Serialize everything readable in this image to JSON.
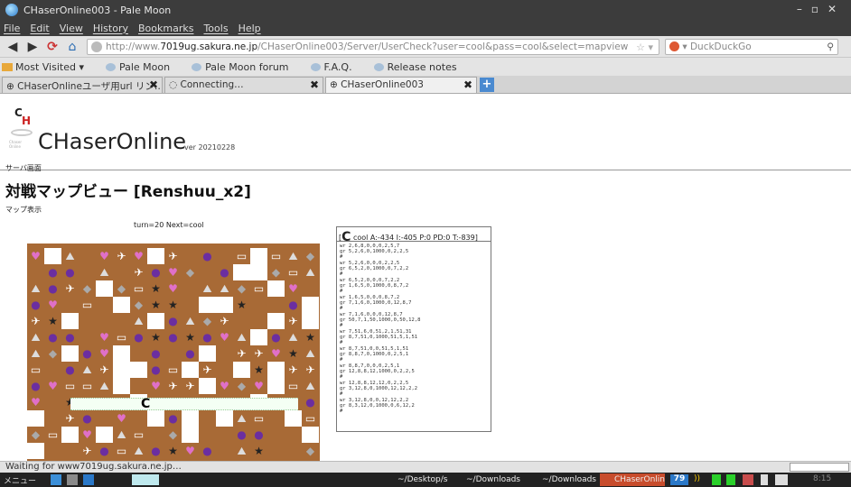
{
  "window": {
    "title": "CHaserOnline003 - Pale Moon"
  },
  "menu": [
    "File",
    "Edit",
    "View",
    "History",
    "Bookmarks",
    "Tools",
    "Help"
  ],
  "nav": {
    "url_prefix": "http://www.",
    "url_host": "7019ug.sakura.ne.jp",
    "url_path": "/CHaserOnline003/Server/UserCheck?user=cool&pass=cool&select=mapview",
    "search_engine": "DuckDuckGo"
  },
  "bookmarks": [
    "Most Visited ▾",
    "Pale Moon",
    "Pale Moon forum",
    "F.A.Q.",
    "Release notes"
  ],
  "tabs": [
    {
      "label": "CHaserOnlineユーザ用url リン…"
    },
    {
      "label": "Connecting…"
    },
    {
      "label": "CHaserOnline003"
    }
  ],
  "page": {
    "logo_caption": "Chaser Online",
    "app_title": "CHaserOnline",
    "app_version": "ver 20210228",
    "breadcrumb": "サーバ画面",
    "heading": "対戦マップビュー [Renshuu_x2]",
    "subheading": "マップ表示",
    "turn_info": "turn=20 Next=cool",
    "panel_header_letter": "C",
    "panel_header_text": "cool A:-434 I:-405 P:0 PD:0 T:-839]",
    "log": [
      [
        "wr 2,6,8,0,0,0,2,5,7",
        "gr 5,2,6,0,1000,0,2,2,5",
        "#"
      ],
      [
        "wr 5,2,6,0,0,0,2,2,5",
        "gr 6,5,2,0,1000,0,7,2,2",
        "#"
      ],
      [
        "wr 6,5,2,0,0,0,7,2,2",
        "gr 1,6,5,0,1000,0,8,7,2",
        "#"
      ],
      [
        "wr 1,6,5,0,0,0,8,7,2",
        "gr 7,1,6,0,1000,0,12,8,7",
        "#"
      ],
      [
        "wr 7,1,6,0,0,0,12,8,7",
        "gr 50,7,1,50,1000,0,50,12,8",
        "#"
      ],
      [
        "wr 7,51,6,0,51,2,1,51,31",
        "gr 8,7,51,0,1000,51,5,1,51",
        "#"
      ],
      [
        "wr 8,7,51,0,0,51,5,1,51",
        "gr 8,8,7,0,1000,0,2,5,1",
        "#"
      ],
      [
        "wr 8,8,7,0,0,0,2,5,1",
        "gr 12,8,8,12,1000,0,2,2,5",
        "#"
      ],
      [
        "wr 12,8,8,12,12,0,2,2,5",
        "gr 3,12,8,0,1000,12,12,2,2",
        "#"
      ],
      [
        "wr 3,12,8,0,0,12,12,2,2",
        "gr 8,3,12,0,1000,0,6,12,2",
        "#"
      ]
    ],
    "player_marker": "C"
  },
  "status_text": "Waiting for www7019ug.sakura.ne.jp…",
  "taskbar": {
    "start": "メニュー",
    "items": [
      "~/Desktop/sc",
      "~/Downloads",
      "~/Downloads",
      "CHaserOnlin"
    ],
    "badge": "79",
    "clock": "8:15"
  },
  "colors": {
    "board_bg": "#a86a36",
    "accent_tab": "#c84c2c",
    "block_white": "#ffffff"
  }
}
